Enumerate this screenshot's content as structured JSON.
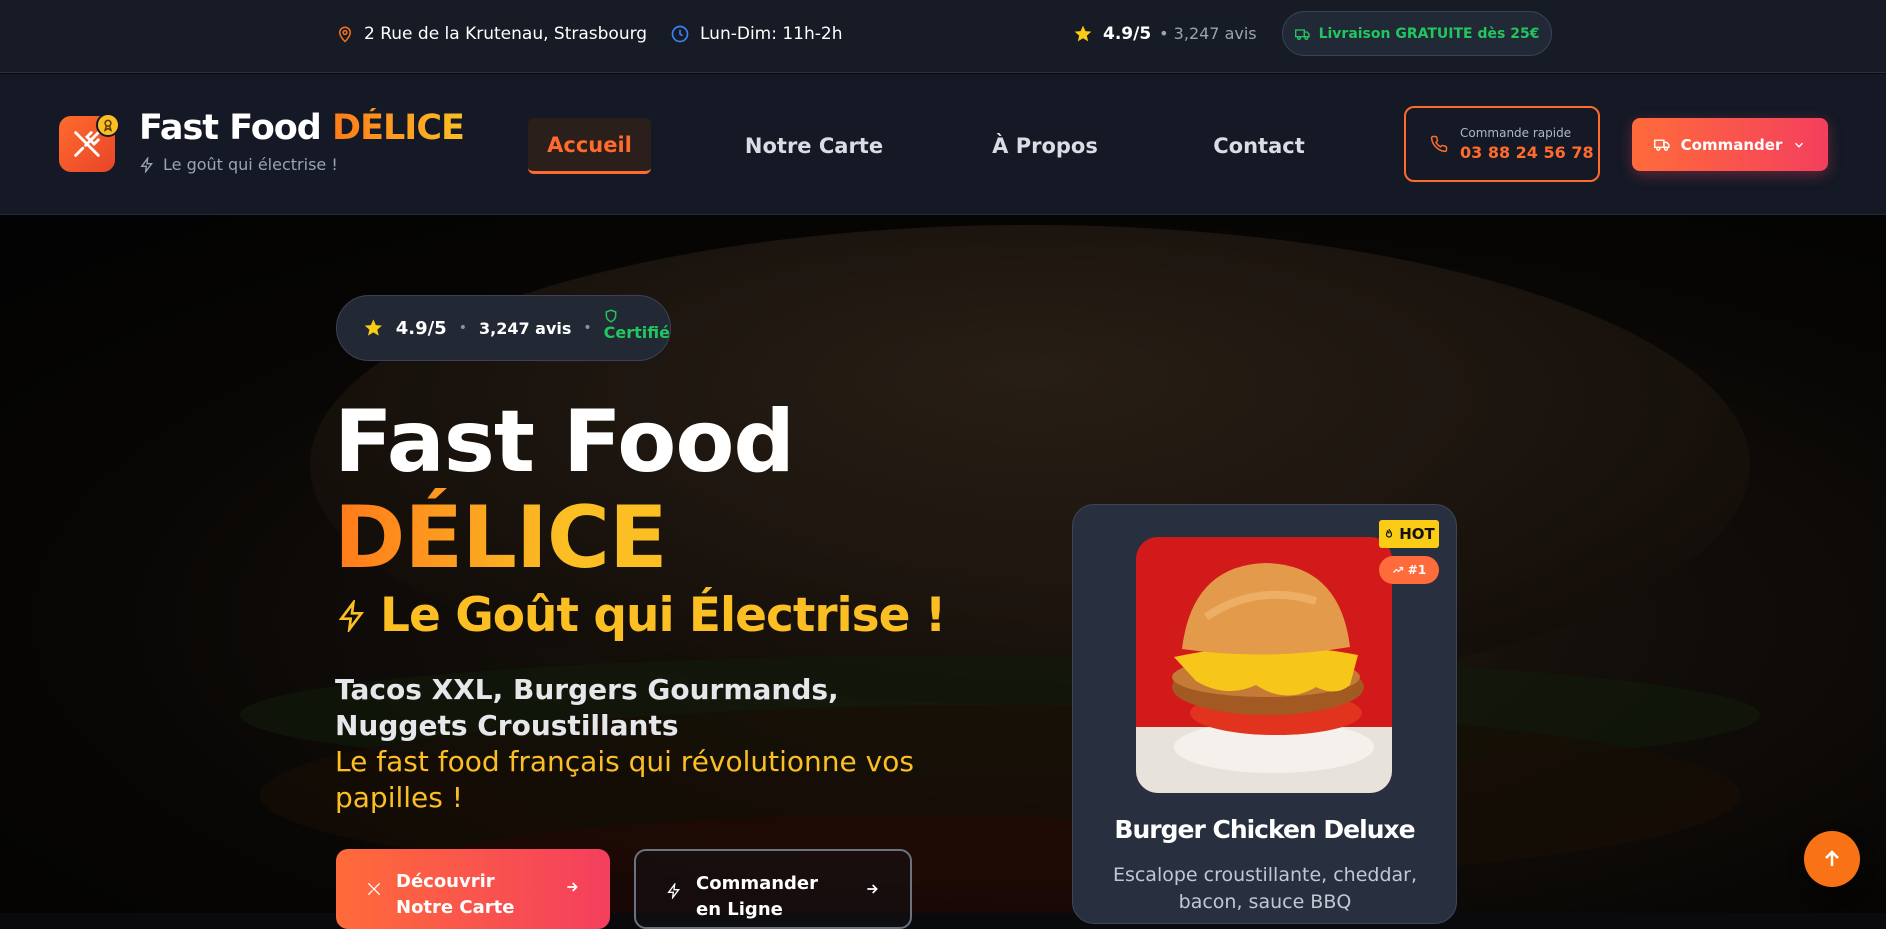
{
  "topbar": {
    "address": "2 Rue de la Krutenau, Strasbourg",
    "hours": "Lun-Dim: 11h-2h",
    "rating": "4.9/5",
    "reviews": "• 3,247 avis",
    "delivery": "Livraison GRATUITE dès 25€"
  },
  "brand": {
    "name_part1": "Fast Food ",
    "name_part2": "DÉLICE",
    "tagline": "Le goût qui électrise !"
  },
  "nav": {
    "items": [
      {
        "label": "Accueil"
      },
      {
        "label": "Notre Carte"
      },
      {
        "label": "À Propos"
      },
      {
        "label": "Contact"
      }
    ],
    "quick_label": "Commande rapide",
    "quick_phone": "03 88 24 56 78",
    "order_button": "Commander"
  },
  "hero": {
    "rating": "4.9/5",
    "separator": "•",
    "reviews": "3,247 avis",
    "certified": "Certifié",
    "title_line1": "Fast Food",
    "title_line2": "DÉLICE",
    "subtitle": "Le Goût qui Électrise !",
    "description": "Tacos XXL, Burgers Gourmands, Nuggets Croustillants",
    "tagline": "Le fast food français qui révolutionne vos papilles !",
    "cta_primary": "Découvrir Notre Carte",
    "cta_secondary": "Commander en Ligne"
  },
  "featured": {
    "badge_hot": "HOT",
    "badge_rank": "#1",
    "title": "Burger Chicken Deluxe",
    "description": "Escalope croustillante, cheddar, bacon, sauce BBQ"
  },
  "colors": {
    "accent": "#ff6b2c",
    "gold": "#fbbf24",
    "green": "#22c55e",
    "hot": "#facc15"
  },
  "icons": [
    "map-pin-icon",
    "clock-icon",
    "star-icon",
    "truck-icon",
    "utensils-icon",
    "award-icon",
    "bolt-icon",
    "phone-icon",
    "chevron-down-icon",
    "shield-icon",
    "arrow-right-icon",
    "flame-icon",
    "trending-up-icon",
    "arrow-up-icon"
  ]
}
